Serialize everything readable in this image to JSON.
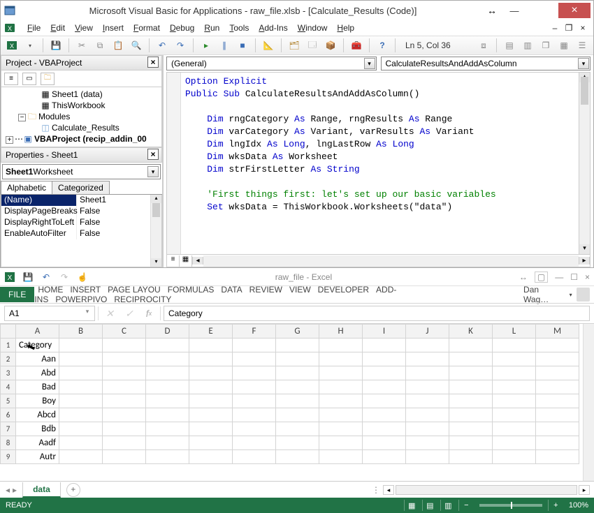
{
  "vbe": {
    "title": "Microsoft Visual Basic for Applications - raw_file.xlsb - [Calculate_Results (Code)]",
    "menu": [
      "File",
      "Edit",
      "View",
      "Insert",
      "Format",
      "Debug",
      "Run",
      "Tools",
      "Add-Ins",
      "Window",
      "Help"
    ],
    "toolbar_status": "Ln 5, Col 36",
    "project": {
      "title": "Project - VBAProject",
      "node_sheet": "Sheet1 (data)",
      "node_wb": "ThisWorkbook",
      "node_modfolder": "Modules",
      "node_module": "Calculate_Results",
      "node_addin": "VBAProject (recip_addin_00"
    },
    "properties": {
      "title": "Properties - Sheet1",
      "combo_bold": "Sheet1",
      "combo_rest": " Worksheet",
      "tab1": "Alphabetic",
      "tab2": "Categorized",
      "rows": [
        {
          "n": "(Name)",
          "v": "Sheet1",
          "sel": true
        },
        {
          "n": "DisplayPageBreaks",
          "v": "False"
        },
        {
          "n": "DisplayRightToLeft",
          "v": "False"
        },
        {
          "n": "EnableAutoFilter",
          "v": "False"
        }
      ]
    },
    "code": {
      "combo_left": "(General)",
      "combo_right": "CalculateResultsAndAddAsColumn",
      "lines": [
        {
          "seg": [
            {
              "t": "Option Explicit",
              "c": "kw-blue"
            }
          ]
        },
        {
          "seg": [
            {
              "t": "Public Sub",
              "c": "kw-blue"
            },
            {
              "t": " CalculateResultsAndAddAsColumn()"
            }
          ]
        },
        {
          "seg": [
            {
              "t": ""
            }
          ]
        },
        {
          "seg": [
            {
              "t": "    "
            },
            {
              "t": "Dim",
              "c": "kw-blue"
            },
            {
              "t": " rngCategory "
            },
            {
              "t": "As",
              "c": "kw-blue"
            },
            {
              "t": " Range, rngResults "
            },
            {
              "t": "As",
              "c": "kw-blue"
            },
            {
              "t": " Range"
            }
          ]
        },
        {
          "seg": [
            {
              "t": "    "
            },
            {
              "t": "Dim",
              "c": "kw-blue"
            },
            {
              "t": " varCategory "
            },
            {
              "t": "As",
              "c": "kw-blue"
            },
            {
              "t": " Variant, varResults "
            },
            {
              "t": "As",
              "c": "kw-blue"
            },
            {
              "t": " Variant"
            }
          ]
        },
        {
          "seg": [
            {
              "t": "    "
            },
            {
              "t": "Dim",
              "c": "kw-blue"
            },
            {
              "t": " lngIdx "
            },
            {
              "t": "As",
              "c": "kw-blue"
            },
            {
              "t": " "
            },
            {
              "t": "Long",
              "c": "kw-blue"
            },
            {
              "t": ", lngLastRow "
            },
            {
              "t": "As",
              "c": "kw-blue"
            },
            {
              "t": " "
            },
            {
              "t": "Long",
              "c": "kw-blue"
            }
          ]
        },
        {
          "seg": [
            {
              "t": "    "
            },
            {
              "t": "Dim",
              "c": "kw-blue"
            },
            {
              "t": " wksData "
            },
            {
              "t": "As",
              "c": "kw-blue"
            },
            {
              "t": " Worksheet"
            }
          ]
        },
        {
          "seg": [
            {
              "t": "    "
            },
            {
              "t": "Dim",
              "c": "kw-blue"
            },
            {
              "t": " strFirstLetter "
            },
            {
              "t": "As",
              "c": "kw-blue"
            },
            {
              "t": " "
            },
            {
              "t": "String",
              "c": "kw-blue"
            }
          ]
        },
        {
          "seg": [
            {
              "t": ""
            }
          ]
        },
        {
          "seg": [
            {
              "t": "    "
            },
            {
              "t": "'First things first: let's set up our basic variables",
              "c": "kw-green"
            }
          ]
        },
        {
          "seg": [
            {
              "t": "    "
            },
            {
              "t": "Set",
              "c": "kw-blue"
            },
            {
              "t": " wksData = ThisWorkbook.Worksheets(\"data\")"
            }
          ]
        }
      ]
    }
  },
  "excel": {
    "title": "raw_file - Excel",
    "ribbon_file": "FILE",
    "ribbon_tabs": [
      "HOME",
      "INSERT",
      "PAGE LAYOU",
      "FORMULAS",
      "DATA",
      "REVIEW",
      "VIEW",
      "DEVELOPER",
      "ADD-INS",
      "POWERPIVO",
      "RECIPROCITY"
    ],
    "account": "Dan Wag…",
    "namebox": "A1",
    "formula": "Category",
    "columns": [
      "A",
      "B",
      "C",
      "D",
      "E",
      "F",
      "G",
      "H",
      "I",
      "J",
      "K",
      "L",
      "M"
    ],
    "rows": [
      {
        "n": "1",
        "cells": [
          "Category"
        ]
      },
      {
        "n": "2",
        "cells": [
          "Aan"
        ],
        "align": "r"
      },
      {
        "n": "3",
        "cells": [
          "Abd"
        ],
        "align": "r"
      },
      {
        "n": "4",
        "cells": [
          "Bad"
        ],
        "align": "r"
      },
      {
        "n": "5",
        "cells": [
          "Boy"
        ],
        "align": "r"
      },
      {
        "n": "6",
        "cells": [
          "Abcd"
        ],
        "align": "r"
      },
      {
        "n": "7",
        "cells": [
          "Bdb"
        ],
        "align": "r"
      },
      {
        "n": "8",
        "cells": [
          "Aadf"
        ],
        "align": "r"
      },
      {
        "n": "9",
        "cells": [
          "Autr"
        ],
        "align": "r"
      }
    ],
    "sheet_tab": "data",
    "status_left": "READY",
    "zoom": "100%"
  }
}
